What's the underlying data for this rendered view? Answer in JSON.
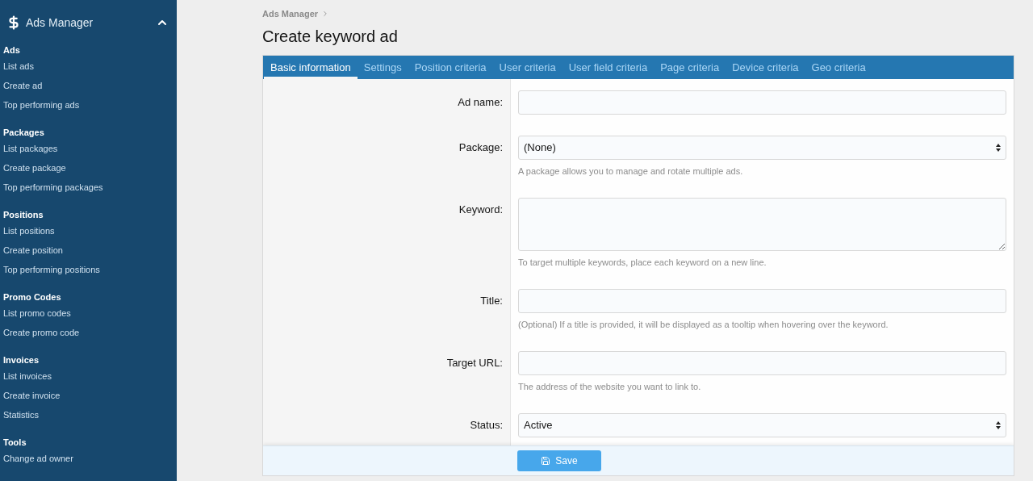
{
  "sidebar": {
    "title": "Ads Manager",
    "expanded": true,
    "sections": [
      {
        "heading": "Ads",
        "items": [
          "List ads",
          "Create ad",
          "Top performing ads"
        ]
      },
      {
        "heading": "Packages",
        "items": [
          "List packages",
          "Create package",
          "Top performing packages"
        ]
      },
      {
        "heading": "Positions",
        "items": [
          "List positions",
          "Create position",
          "Top performing positions"
        ]
      },
      {
        "heading": "Promo Codes",
        "items": [
          "List promo codes",
          "Create promo code"
        ]
      },
      {
        "heading": "Invoices",
        "items": [
          "List invoices",
          "Create invoice",
          "Statistics"
        ]
      },
      {
        "heading": "Tools",
        "items": [
          "Change ad owner"
        ]
      }
    ]
  },
  "breadcrumb": [
    "Ads Manager"
  ],
  "page_title": "Create keyword ad",
  "tabs": [
    {
      "label": "Basic information",
      "selected": true
    },
    {
      "label": "Settings",
      "selected": false
    },
    {
      "label": "Position criteria",
      "selected": false
    },
    {
      "label": "User criteria",
      "selected": false
    },
    {
      "label": "User field criteria",
      "selected": false
    },
    {
      "label": "Page criteria",
      "selected": false
    },
    {
      "label": "Device criteria",
      "selected": false
    },
    {
      "label": "Geo criteria",
      "selected": false
    }
  ],
  "form": [
    {
      "kind": "text",
      "label": "Ad name:"
    },
    {
      "kind": "select",
      "label": "Package:",
      "value": "(None)",
      "hint": "A package allows you to manage and rotate multiple ads."
    },
    {
      "kind": "textarea",
      "label": "Keyword:",
      "hint": "To target multiple keywords, place each keyword on a new line."
    },
    {
      "kind": "text",
      "label": "Title:",
      "hint": "(Optional) If a title is provided, it will be displayed as a tooltip when hovering over the keyword."
    },
    {
      "kind": "text",
      "label": "Target URL:",
      "hint": "The address of the website you want to link to."
    },
    {
      "kind": "select",
      "label": "Status:",
      "value": "Active"
    }
  ],
  "save_button": "Save"
}
